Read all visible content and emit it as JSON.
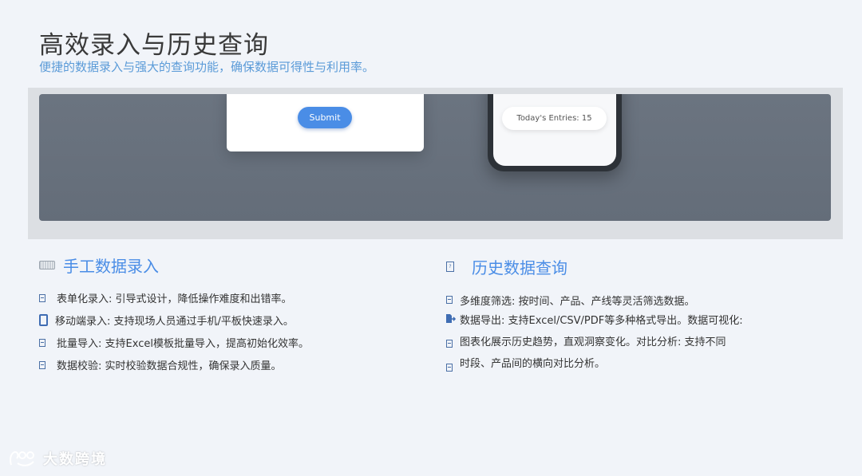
{
  "page": {
    "title": "高效录入与历史查询",
    "subtitle": "便捷的数据录入与强大的查询功能，确保数据可得性与利用率。"
  },
  "banner": {
    "form_card": {
      "submit_label": "Submit"
    },
    "phone": {
      "entries_text": "Today's Entries: 15"
    }
  },
  "manual_entry": {
    "heading": "手工数据录入",
    "items": [
      "表单化录入: 引导式设计，降低操作难度和出错率。",
      "移动端录入: 支持现场人员通过手机/平板快速录入。",
      "批量导入: 支持Excel模板批量导入，提高初始化效率。",
      "数据校验: 实时校验数据合规性，确保录入质量。"
    ]
  },
  "history_query": {
    "heading": "历史数据查询",
    "lines": [
      "多维度筛选: 按时间、产品、产线等灵活筛选数据。",
      "数据导出: 支持Excel/CSV/PDF等多种格式导出。数据可视化:",
      "图表化展示历史趋势，直观洞察变化。对比分析: 支持不同",
      "时段、产品间的横向对比分析。"
    ]
  },
  "watermark": {
    "text": "大数跨境"
  },
  "colors": {
    "accent": "#4a8de6",
    "subtitle": "#5b9bd8",
    "background": "#f1f4f9",
    "banner": "#67707c"
  }
}
